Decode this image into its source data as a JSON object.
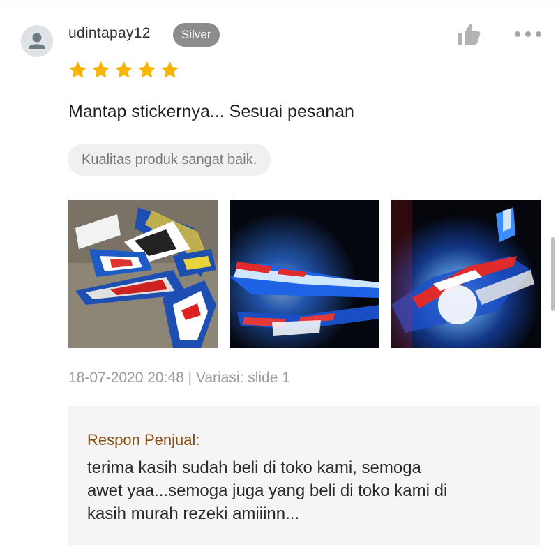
{
  "review": {
    "username": "udintapay12",
    "tier_badge": "Silver",
    "rating": 5,
    "rating_max": 5,
    "text": "Mantap stickernya... Sesuai pesanan",
    "quality_tag": "Kualitas produk sangat baik.",
    "meta": "18-07-2020 20:48 | Variasi: slide 1",
    "photos": [
      {
        "name": "sticker-sheet-photo"
      },
      {
        "name": "motorbike-lights-photo"
      },
      {
        "name": "motorbike-front-photo"
      }
    ]
  },
  "seller_response": {
    "label": "Respon Penjual:",
    "lines": [
      "terima kasih sudah beli di toko kami, semoga",
      "awet yaa...semoga juga yang beli di toko kami di",
      "kasih murah rezeki amiiinn..."
    ]
  },
  "icons": {
    "avatar": "user-avatar-icon",
    "like": "thumbs-up-icon",
    "more": "more-options-icon",
    "star": "star-icon"
  },
  "colors": {
    "star": "#f7b500",
    "badge_bg": "#8c8c8c",
    "response_label": "#8a4e14",
    "response_bg": "#f5f5f5",
    "chip_bg": "#f0f0f0"
  }
}
